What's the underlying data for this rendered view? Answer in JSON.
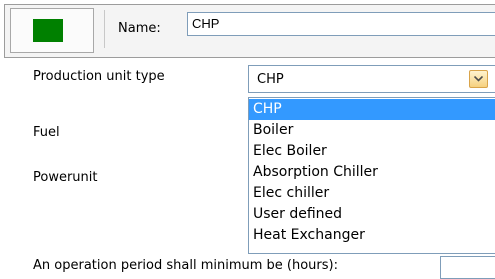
{
  "header": {
    "name_label": "Name:",
    "name_value": "CHP",
    "color_swatch": "#008000"
  },
  "form": {
    "production_unit_type_label": "Production unit type",
    "fuel_label": "Fuel",
    "powerunit_label": "Powerunit",
    "operation_period_label": "An operation period shall minimum be (hours):",
    "type_select_value": "CHP",
    "options": [
      {
        "label": "CHP",
        "selected": true
      },
      {
        "label": "Boiler",
        "selected": false
      },
      {
        "label": "Elec Boiler",
        "selected": false
      },
      {
        "label": "Absorption Chiller",
        "selected": false
      },
      {
        "label": "Elec chiller",
        "selected": false
      },
      {
        "label": "User defined",
        "selected": false
      },
      {
        "label": "Heat Exchanger",
        "selected": false
      }
    ]
  },
  "colors": {
    "selection": "#3399ff",
    "field_border": "#7f9db9"
  }
}
